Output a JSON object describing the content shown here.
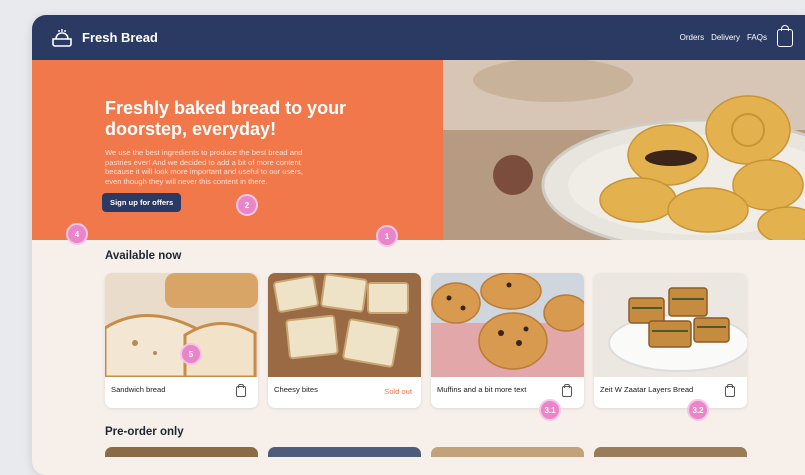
{
  "app": {
    "name": "Fresh Bread"
  },
  "nav": {
    "orders": "Orders",
    "delivery": "Delivery",
    "faqs": "FAQs"
  },
  "hero": {
    "title": "Freshly baked bread to your doorstep, everyday!",
    "body": "We use the best ingredients to produce the best bread and pastries ever! And we decided to add a bit of more content because it will look more important and useful to our users, even though they will never this content in there.",
    "cta": "Sign up for offers"
  },
  "sections": {
    "available": "Available now",
    "preorder": "Pre-order only"
  },
  "products": [
    {
      "name": "Sandwich bread",
      "status": ""
    },
    {
      "name": "Cheesy bites",
      "status": "Sold out"
    },
    {
      "name": "Muffins and a bit more text",
      "status": ""
    },
    {
      "name": "Zeit W Zaatar Layers Bread",
      "status": ""
    }
  ],
  "badges": [
    "1",
    "2",
    "3.1",
    "3.2",
    "4",
    "5"
  ],
  "colors": {
    "navy": "#2b3a63",
    "orange": "#f0784a",
    "cream": "#f7efe9",
    "badge": "#e985c8"
  }
}
